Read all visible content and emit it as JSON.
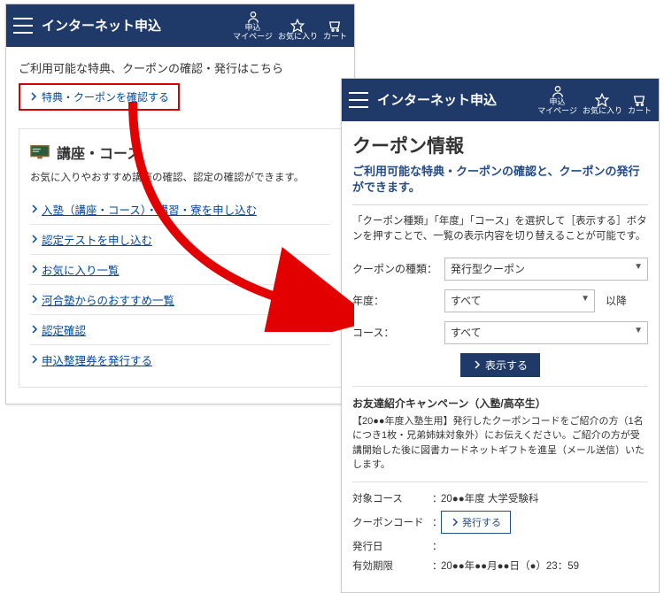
{
  "left": {
    "header": {
      "title": "インターネット申込",
      "icons": {
        "mypage": "申込\nマイページ",
        "fav": "お気に入り",
        "cart": "カート"
      }
    },
    "intro": "ご利用可能な特典、クーポンの確認・発行はこちら",
    "confirm_btn": "特典・クーポンを確認する",
    "section": {
      "title": "講座・コース",
      "desc": "お気に入りやおすすめ講座の確認、認定の確認ができます。",
      "links": [
        "入塾（講座・コース）・講習・寮を申し込む",
        "認定テストを申し込む",
        "お気に入り一覧",
        "河合塾からのおすすめ一覧",
        "認定確認",
        "申込整理券を発行する"
      ]
    }
  },
  "right": {
    "header": {
      "title": "インターネット申込",
      "icons": {
        "mypage": "申込\nマイページ",
        "fav": "お気に入り",
        "cart": "カート"
      }
    },
    "page_title": "クーポン情報",
    "subtitle": "ご利用可能な特典・クーポンの確認と、クーポンの発行ができます。",
    "note": "「クーポン種類」「年度」「コース」を選択して［表示する］ボタンを押すことで、一覧の表示内容を切り替えることが可能です。",
    "form": {
      "type_label": "クーポンの種類：",
      "type_value": "発行型クーポン",
      "year_label": "年度：",
      "year_value": "すべて",
      "year_suffix": "以降",
      "course_label": "コース：",
      "course_value": "すべて",
      "submit": "表示する"
    },
    "campaign": {
      "title": "お友達紹介キャンペーン（入塾/高卒生）",
      "desc": "【20●●年度入塾生用】発行したクーポンコードをご紹介の方（1名につき1枚・兄弟姉妹対象外）にお伝えください。ご紹介の方が受講開始した後に図書カードネットギフトを進呈（メール送信）いたします。"
    },
    "info": {
      "course_label": "対象コース",
      "course_value": "20●●年度 大学受験科",
      "code_label": "クーポンコード",
      "code_btn": "発行する",
      "date_label": "発行日",
      "date_value": "",
      "expire_label": "有効期限",
      "expire_value": "20●●年●●月●●日（●）23：59"
    }
  }
}
